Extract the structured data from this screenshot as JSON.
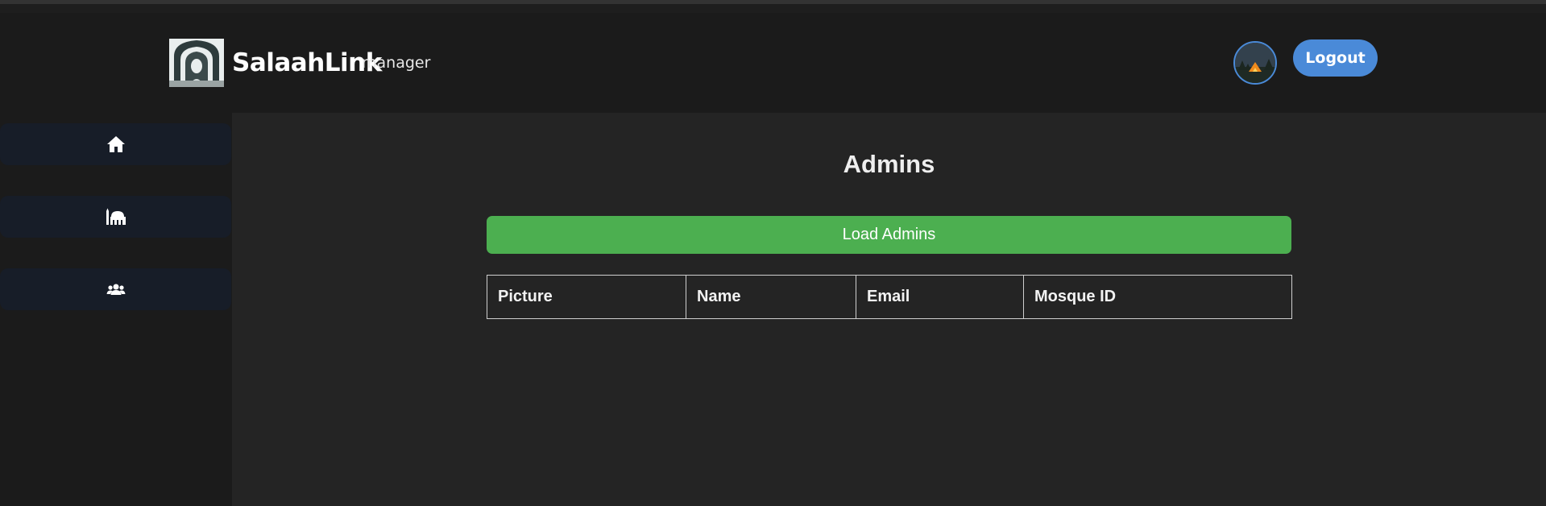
{
  "header": {
    "brand_name": "SalaahLink",
    "brand_role": "manager",
    "logout_label": "Logout"
  },
  "sidebar": {
    "items": [
      {
        "icon": "home-icon"
      },
      {
        "icon": "mosque-icon"
      },
      {
        "icon": "users-icon"
      }
    ]
  },
  "main": {
    "title": "Admins",
    "load_button_label": "Load Admins",
    "table": {
      "columns": [
        "Picture",
        "Name",
        "Email",
        "Mosque ID"
      ],
      "rows": []
    }
  },
  "colors": {
    "accent_blue": "#4a8ad8",
    "load_green": "#4caf50",
    "background": "#242424",
    "header_bg": "#1b1b1b",
    "sidebar_button_bg": "#171d28"
  }
}
